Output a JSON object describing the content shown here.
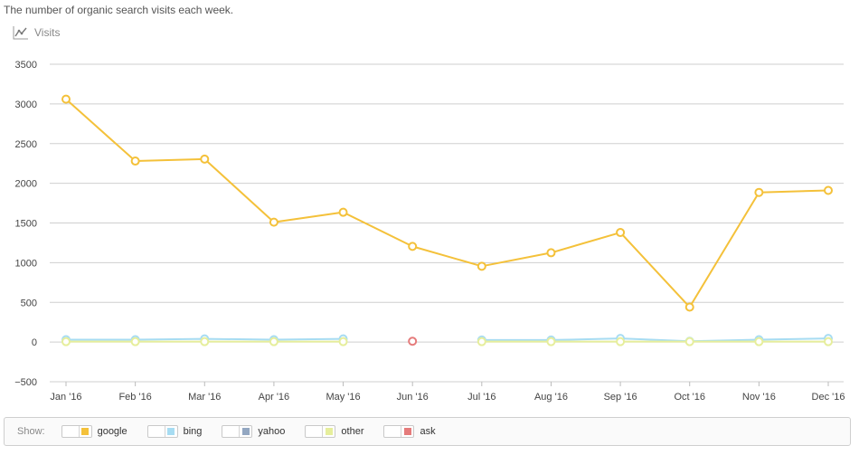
{
  "header": {
    "subtitle": "The number of organic search visits each week.",
    "metric_label": "Visits",
    "metric_icon": "line-chart-icon"
  },
  "legend": {
    "show_label": "Show:",
    "items": [
      {
        "label": "google",
        "color": "#f4c13a"
      },
      {
        "label": "bing",
        "color": "#a7dcf2"
      },
      {
        "label": "yahoo",
        "color": "#93a7c1"
      },
      {
        "label": "other",
        "color": "#e6ee9c"
      },
      {
        "label": "ask",
        "color": "#e57b7b"
      }
    ]
  },
  "chart_data": {
    "type": "line",
    "categories": [
      "Jan '16",
      "Feb '16",
      "Mar '16",
      "Apr '16",
      "May '16",
      "Jun '16",
      "Jul '16",
      "Aug '16",
      "Sep '16",
      "Oct '16",
      "Nov '16",
      "Dec '16"
    ],
    "y_ticks": [
      "3500",
      "3000",
      "2500",
      "2000",
      "1500",
      "1000",
      "500",
      "0",
      "−500"
    ],
    "ylim": [
      -500,
      3500
    ],
    "grid": true,
    "series": [
      {
        "name": "bing",
        "color": "#a7dcf2",
        "values": [
          30,
          30,
          40,
          30,
          40,
          null,
          25,
          25,
          45,
          10,
          30,
          45
        ]
      },
      {
        "name": "other",
        "color": "#e6ee9c",
        "values": [
          5,
          5,
          5,
          5,
          5,
          null,
          5,
          5,
          5,
          5,
          5,
          5
        ]
      },
      {
        "name": "ask",
        "color": "#e57b7b",
        "values": [
          null,
          null,
          null,
          null,
          null,
          10,
          null,
          null,
          null,
          null,
          null,
          null
        ]
      },
      {
        "name": "google",
        "color": "#f4c13a",
        "values": [
          3060,
          2280,
          2305,
          1510,
          1635,
          1205,
          955,
          1125,
          1380,
          440,
          1885,
          1910
        ]
      }
    ]
  }
}
